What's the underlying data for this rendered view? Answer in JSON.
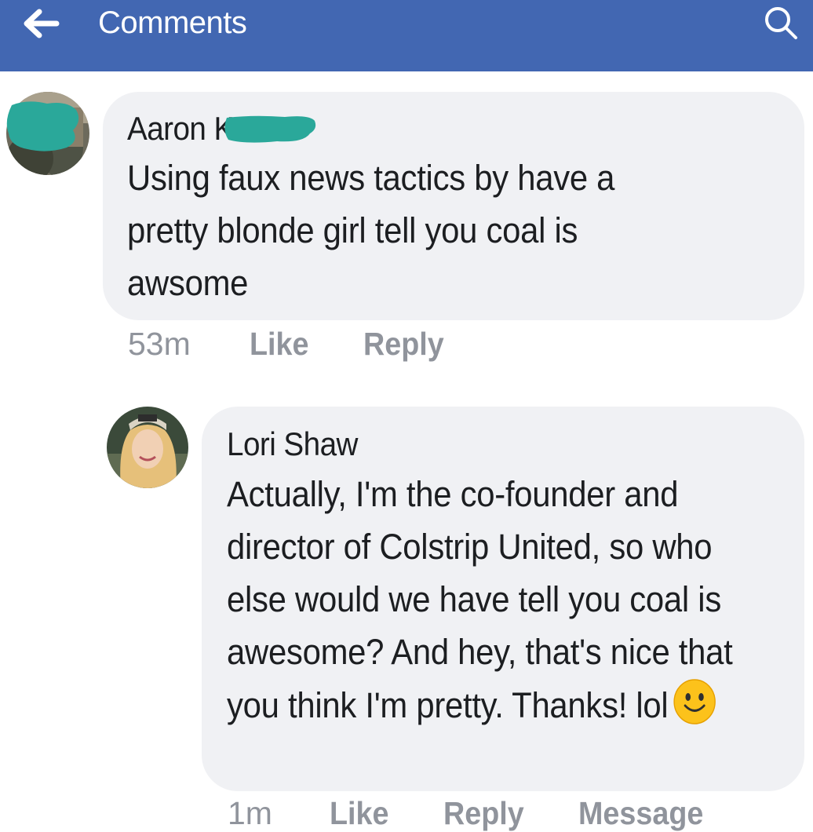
{
  "header": {
    "title": "Comments",
    "back_icon": "arrow-left-icon",
    "search_icon": "search-icon",
    "bar_color": "#4267b2"
  },
  "comments": [
    {
      "author": "Aaron K",
      "text": "Using faux news tactics by have a pretty blonde girl tell you coal is awsome",
      "time": "53m",
      "like_label": "Like",
      "reply_label": "Reply",
      "name_redacted": true
    },
    {
      "author": "Lori Shaw",
      "text": "Actually, I'm the co-founder and director of Colstrip United, so who else would we have tell you coal is awesome? And hey, that's nice that you think I'm pretty. Thanks! lol",
      "emoji": "slightly-smiling-face-icon",
      "time": "1m",
      "like_label": "Like",
      "reply_label": "Reply",
      "message_label": "Message"
    }
  ],
  "colors": {
    "bubble": "#f0f1f4",
    "meta_text": "#90949c",
    "redaction": "#2aa89a"
  }
}
